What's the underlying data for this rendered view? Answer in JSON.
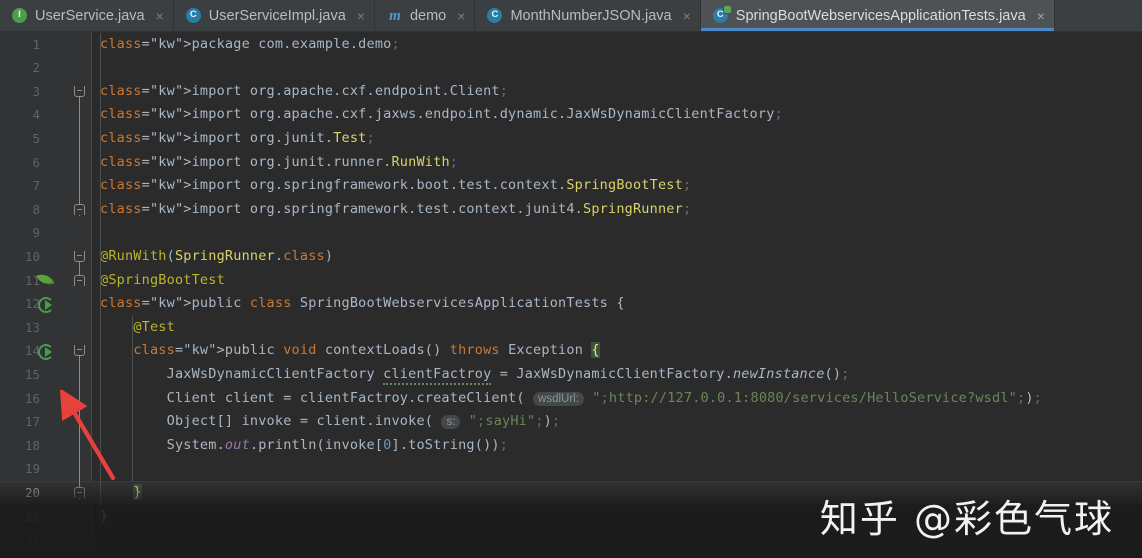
{
  "tabs": [
    {
      "label": "UserService.java",
      "icon": "interface-icon",
      "icon_letter": "I",
      "icon_kind": "interface",
      "active": false,
      "close": "×"
    },
    {
      "label": "UserServiceImpl.java",
      "icon": "class-icon",
      "icon_letter": "C",
      "icon_kind": "class",
      "active": false,
      "close": "×"
    },
    {
      "label": "demo",
      "icon": "maven-module-icon",
      "icon_letter": "m",
      "icon_kind": "maven",
      "active": false,
      "close": "×"
    },
    {
      "label": "MonthNumberJSON.java",
      "icon": "class-icon",
      "icon_letter": "C",
      "icon_kind": "class",
      "active": false,
      "close": "×"
    },
    {
      "label": "SpringBootWebservicesApplicationTests.java",
      "icon": "runnable-class-icon",
      "icon_letter": "C",
      "icon_kind": "class-runnable",
      "active": true,
      "close": "×"
    }
  ],
  "editor": {
    "line_numbers": [
      "1",
      "2",
      "3",
      "4",
      "5",
      "6",
      "7",
      "8",
      "9",
      "10",
      "11",
      "12",
      "13",
      "14",
      "15",
      "16",
      "17",
      "18",
      "19",
      "20",
      "21",
      "22"
    ],
    "current_line": 20,
    "lines": [
      "package com.example.demo;",
      "",
      "import org.apache.cxf.endpoint.Client;",
      "import org.apache.cxf.jaxws.endpoint.dynamic.JaxWsDynamicClientFactory;",
      "import org.junit.Test;",
      "import org.junit.runner.RunWith;",
      "import org.springframework.boot.test.context.SpringBootTest;",
      "import org.springframework.test.context.junit4.SpringRunner;",
      "",
      "@RunWith(SpringRunner.class)",
      "@SpringBootTest",
      "public class SpringBootWebservicesApplicationTests {",
      "    @Test",
      "    public void contextLoads() throws Exception {",
      "        JaxWsDynamicClientFactory clientFactroy = JaxWsDynamicClientFactory.newInstance();",
      "        Client client = clientFactroy.createClient( wsdlUrl: \"http://127.0.0.1:8080/services/HelloService?wsdl\");",
      "        Object[] invoke = client.invoke( s: \"sayHi\");",
      "        System.out.println(invoke[0].toString());",
      "",
      "    }",
      "}",
      ""
    ],
    "parameter_hints": [
      {
        "line": 16,
        "name": "wsdlUrl:"
      },
      {
        "line": 17,
        "name": "s:"
      }
    ],
    "typo_warning": {
      "line": 15,
      "word": "clientFactroy"
    },
    "gutter_icons": [
      {
        "line": 11,
        "icon": "spring-leaf-icon"
      },
      {
        "line": 12,
        "icon": "run-class-icon"
      },
      {
        "line": 14,
        "icon": "run-method-icon"
      }
    ]
  },
  "annotation": {
    "type": "red-arrow",
    "color": "#e8413c",
    "points_to": "run-method-icon-line-14"
  },
  "watermark": {
    "text": "知乎 @彩色气球"
  },
  "colors": {
    "editor_background": "#2b2b2b",
    "gutter_background": "#313335",
    "tab_background": "#3c3f41",
    "active_tab_background": "#4e5254",
    "active_tab_underline": "#4a88c7",
    "keyword": "#cc7832",
    "string": "#6a8759",
    "annotation": "#bbb529",
    "class_name": "#d9d36a",
    "number": "#6897bb",
    "static_field": "#9876aa",
    "default_text": "#a9b7c6",
    "line_number": "#606366"
  }
}
